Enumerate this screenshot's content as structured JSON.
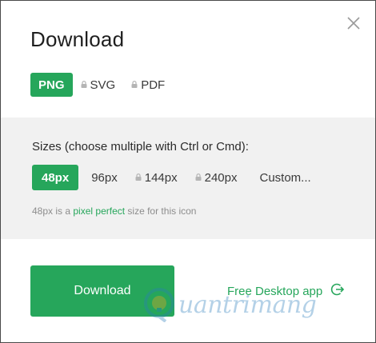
{
  "dialog": {
    "title": "Download",
    "close_icon": "close-icon"
  },
  "formats": [
    {
      "label": "PNG",
      "active": true,
      "locked": false
    },
    {
      "label": "SVG",
      "active": false,
      "locked": true
    },
    {
      "label": "PDF",
      "active": false,
      "locked": true
    }
  ],
  "sizes": {
    "label": "Sizes (choose multiple with Ctrl or Cmd):",
    "options": [
      {
        "label": "48px",
        "active": true,
        "locked": false
      },
      {
        "label": "96px",
        "active": false,
        "locked": false
      },
      {
        "label": "144px",
        "active": false,
        "locked": true
      },
      {
        "label": "240px",
        "active": false,
        "locked": true
      },
      {
        "label": "Custom...",
        "active": false,
        "locked": false
      }
    ],
    "hint_prefix": "48px is a",
    "hint_link": "pixel perfect",
    "hint_suffix": "size for this icon"
  },
  "actions": {
    "download_label": "Download",
    "desktop_label": "Free Desktop app"
  },
  "watermark": {
    "text": "uantrimang"
  },
  "colors": {
    "accent": "#26a65b",
    "panel": "#f1f1f1"
  }
}
